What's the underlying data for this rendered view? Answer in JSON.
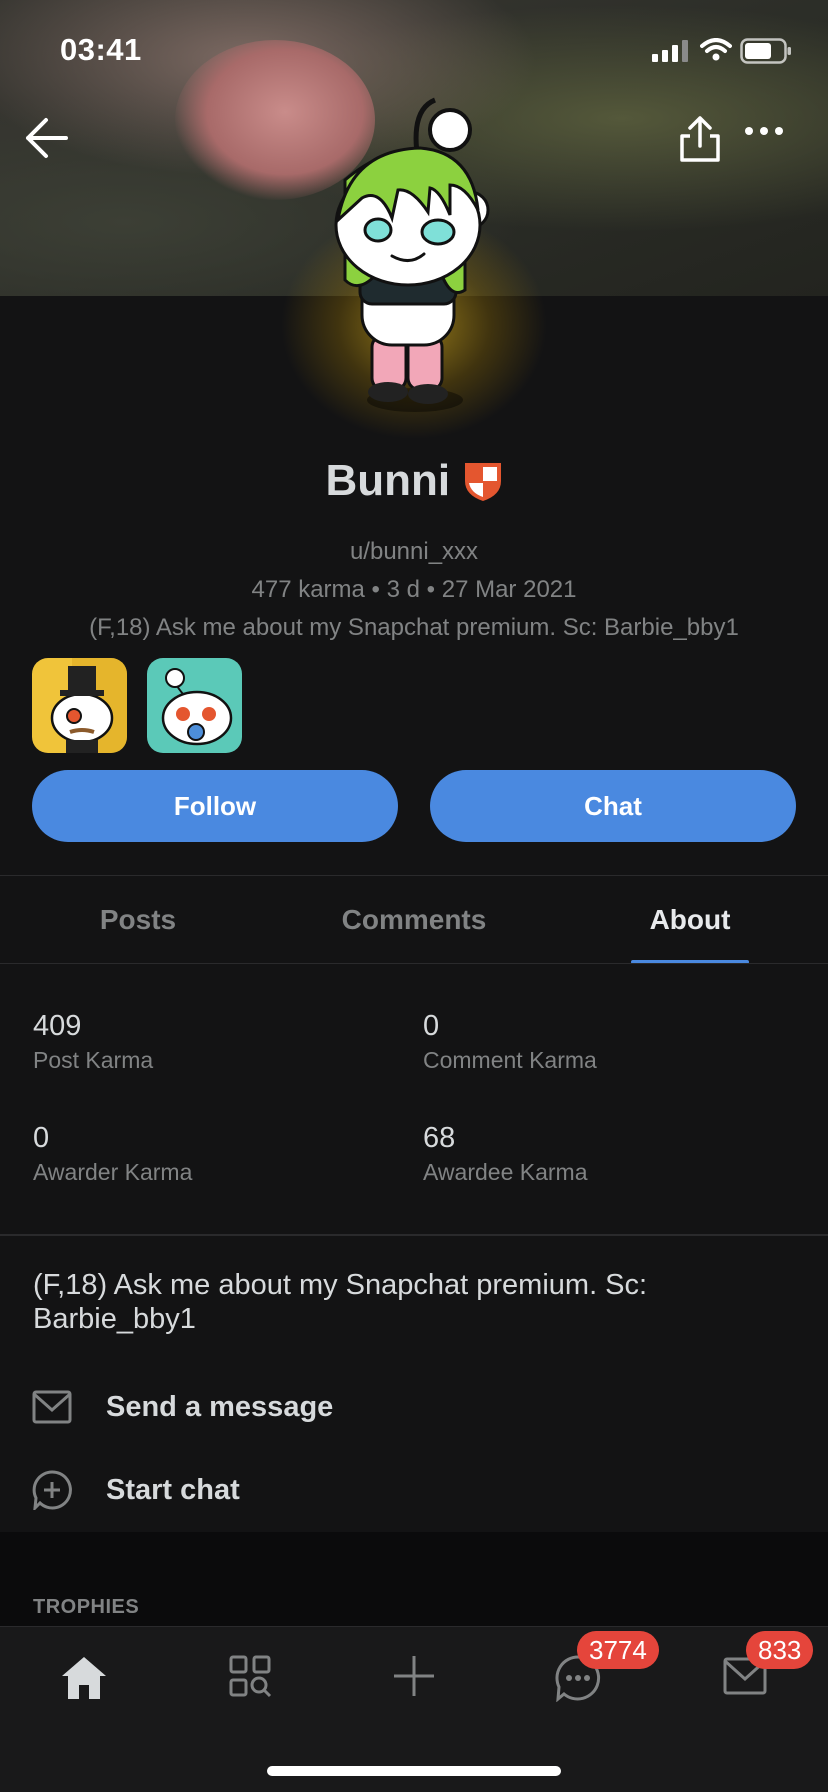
{
  "status_bar": {
    "time": "03:41"
  },
  "profile": {
    "display_name": "Bunni",
    "username": "u/bunni_xxx",
    "meta_line": "477 karma • 3 d • 27 Mar 2021",
    "bio": "(F,18) Ask me about my Snapchat premium. Sc: Barbie_bby1",
    "badge_icons": [
      "top-hat-snoo-badge",
      "pacifier-snoo-badge"
    ]
  },
  "actions": {
    "follow_label": "Follow",
    "chat_label": "Chat"
  },
  "tabs": [
    {
      "label": "Posts",
      "active": false
    },
    {
      "label": "Comments",
      "active": false
    },
    {
      "label": "About",
      "active": true
    }
  ],
  "stats": {
    "post_karma": {
      "value": "409",
      "label": "Post Karma"
    },
    "comment_karma": {
      "value": "0",
      "label": "Comment Karma"
    },
    "awarder_karma": {
      "value": "0",
      "label": "Awarder Karma"
    },
    "awardee_karma": {
      "value": "68",
      "label": "Awardee Karma"
    }
  },
  "about": {
    "bio": "(F,18) Ask me about my Snapchat premium. Sc: Barbie_bby1",
    "send_message_label": "Send a message",
    "start_chat_label": "Start chat"
  },
  "trophies_heading": "TROPHIES",
  "bottom_nav": {
    "items": [
      "home-icon",
      "discover-icon",
      "create-icon",
      "chat-icon",
      "inbox-icon"
    ],
    "chat_badge": "3774",
    "inbox_badge": "833"
  },
  "colors": {
    "accent": "#4a89e0",
    "badge": "#e5453b",
    "background": "#131314",
    "mod_shield": "#e4562f"
  }
}
